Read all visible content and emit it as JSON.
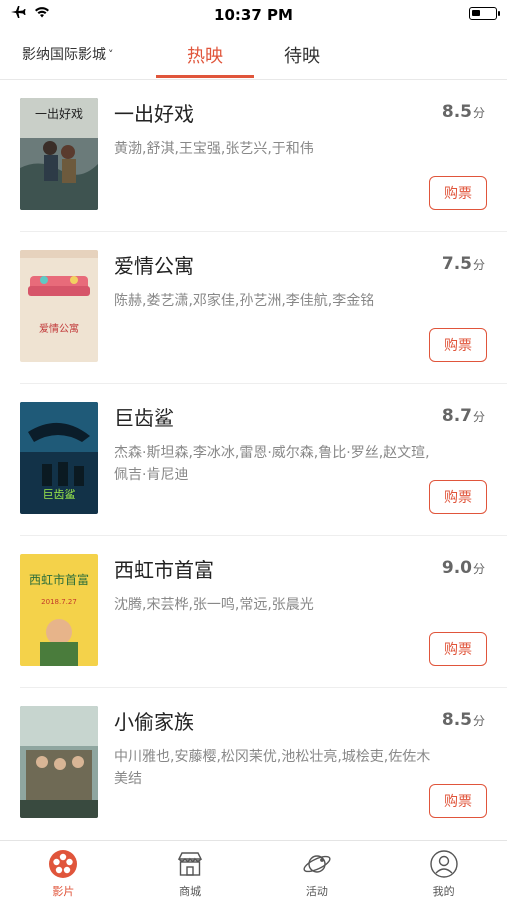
{
  "status": {
    "time": "10:37 PM"
  },
  "nav": {
    "cinema": "影纳国际影城",
    "tabs": [
      {
        "label": "热映"
      },
      {
        "label": "待映"
      }
    ]
  },
  "movies": [
    {
      "title": "一出好戏",
      "score": "8.5",
      "unit": "分",
      "actors": "黄渤,舒淇,王宝强,张艺兴,于和伟",
      "buy": "购票"
    },
    {
      "title": "爱情公寓",
      "score": "7.5",
      "unit": "分",
      "actors": "陈赫,娄艺潇,邓家佳,孙艺洲,李佳航,李金铭",
      "buy": "购票"
    },
    {
      "title": "巨齿鲨",
      "score": "8.7",
      "unit": "分",
      "actors": "杰森·斯坦森,李冰冰,雷恩·威尔森,鲁比·罗丝,赵文瑄,佩吉·肯尼迪",
      "buy": "购票"
    },
    {
      "title": "西虹市首富",
      "score": "9.0",
      "unit": "分",
      "actors": "沈腾,宋芸桦,张一鸣,常远,张晨光",
      "buy": "购票"
    },
    {
      "title": "小偷家族",
      "score": "8.5",
      "unit": "分",
      "actors": "中川雅也,安藤樱,松冈茉优,池松壮亮,城桧吏,佐佐木美结",
      "buy": "购票"
    }
  ],
  "tabbar": [
    {
      "label": "影片",
      "icon": "film-reel-icon"
    },
    {
      "label": "商城",
      "icon": "shop-icon"
    },
    {
      "label": "活动",
      "icon": "planet-icon"
    },
    {
      "label": "我的",
      "icon": "user-icon"
    }
  ],
  "colors": {
    "accent": "#e0553b"
  }
}
